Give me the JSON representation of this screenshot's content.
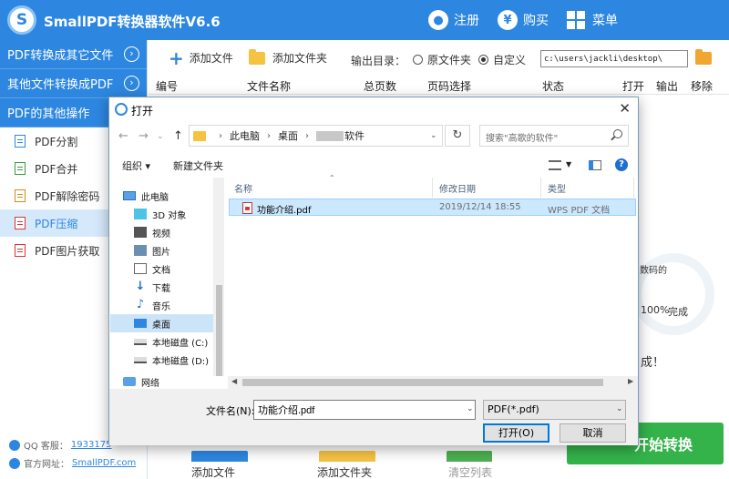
{
  "app": {
    "title": "SmallPDF转换器软件V6.6",
    "logo": "S",
    "register": "注册",
    "buy": "购买",
    "menu": "菜单"
  },
  "sidebar": {
    "groups": [
      "PDF转换成其它文件",
      "其他文件转换成PDF",
      "PDF的其他操作"
    ],
    "items": [
      "PDF分割",
      "PDF合并",
      "PDF解除密码",
      "PDF压缩",
      "PDF图片获取"
    ],
    "qq_label": "QQ 客服：",
    "qq_number": "1933175",
    "site_label": "官方网址：",
    "site_url": "SmallPDF.com"
  },
  "toolbar": {
    "add_file": "添加文件",
    "add_folder": "添加文件夹",
    "output_label": "输出目录：",
    "opt_original": "原文件夹",
    "opt_custom": "自定义",
    "output_path": "c:\\users\\jackli\\desktop\\"
  },
  "table": {
    "headers": [
      "编号",
      "文件名称",
      "总页数",
      "页码选择",
      "状态",
      "打开",
      "输出",
      "移除"
    ]
  },
  "background": {
    "ratio_fragment": "数码的",
    "progress": "100%",
    "done": "完成",
    "done_fragment": "成！",
    "start_button": "开始转换",
    "bottom_buttons": [
      "添加文件",
      "添加文件夹",
      "清空列表"
    ]
  },
  "dialog": {
    "title": "打开",
    "close": "✕",
    "breadcrumb": [
      "此电脑",
      "桌面",
      "软件"
    ],
    "search_placeholder": "搜索\"高歌的软件\"",
    "organize": "组织 ▾",
    "new_folder": "新建文件夹",
    "tree": [
      "此电脑",
      "3D 对象",
      "视频",
      "图片",
      "文档",
      "下载",
      "音乐",
      "桌面",
      "本地磁盘 (C:)",
      "本地磁盘 (D:)",
      "网络"
    ],
    "columns": [
      "名称",
      "修改日期",
      "类型",
      "大"
    ],
    "file": {
      "name": "功能介绍.pdf",
      "date": "2019/12/14 18:55",
      "type": "WPS PDF 文档"
    },
    "filename_label": "文件名(N):",
    "filename_value": "功能介绍.pdf",
    "filetype": "PDF(*.pdf)",
    "open_button": "打开(O)",
    "cancel_button": "取消"
  }
}
